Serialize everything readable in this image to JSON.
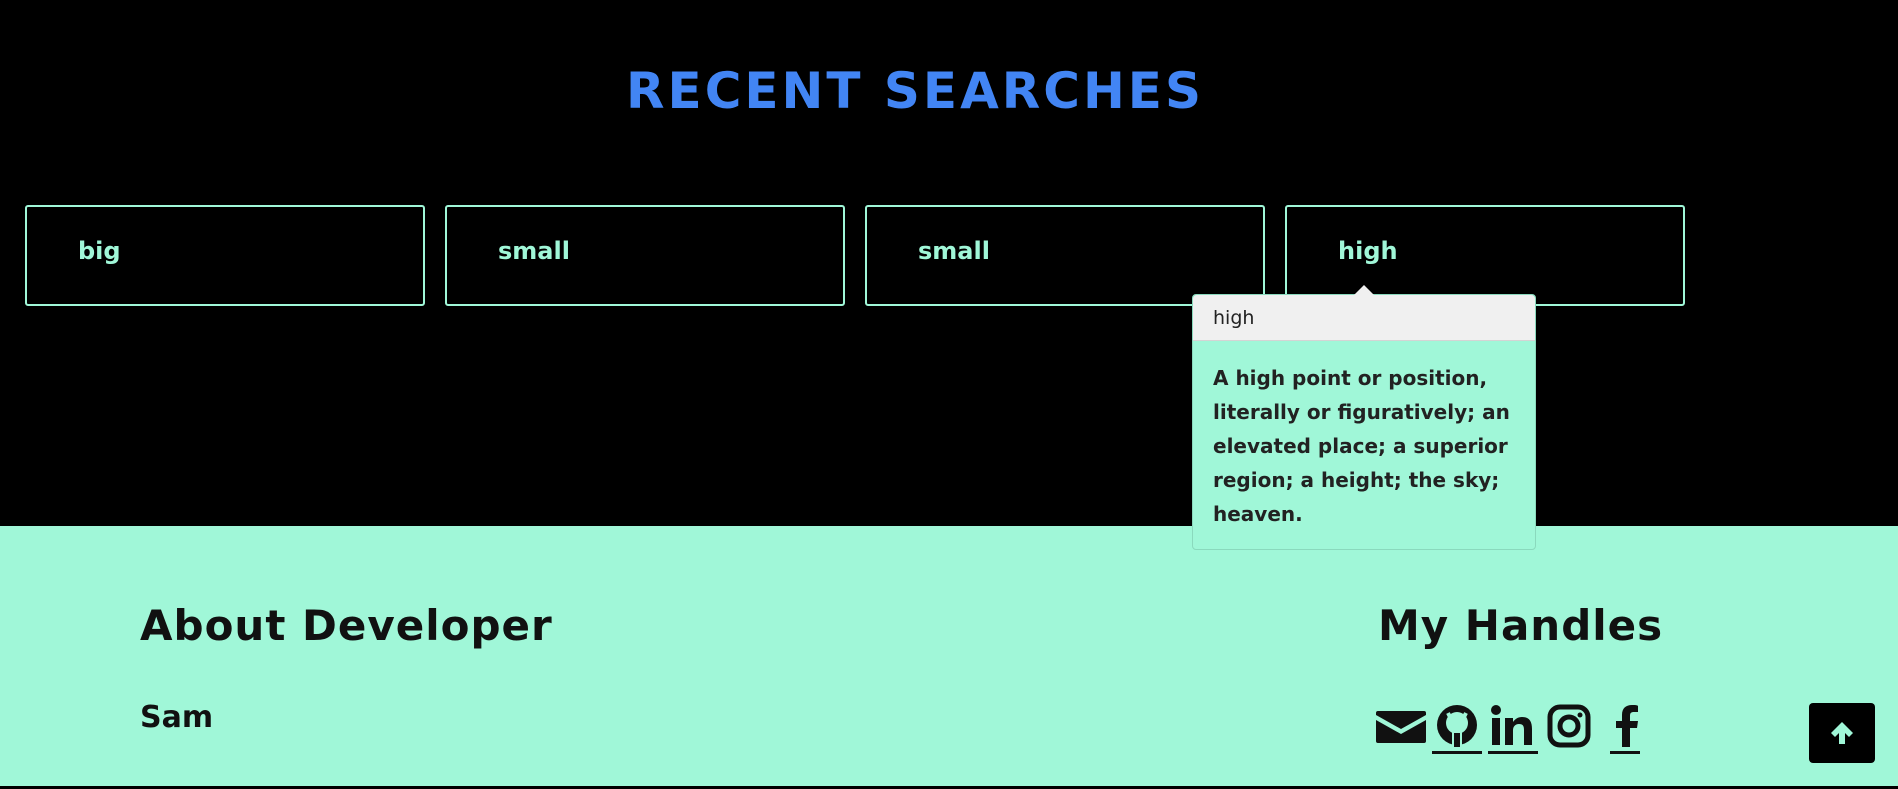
{
  "recent": {
    "title": "RECENT SEARCHES",
    "items": [
      {
        "label": "big"
      },
      {
        "label": "small"
      },
      {
        "label": "small"
      },
      {
        "label": "high"
      }
    ]
  },
  "popover": {
    "title": "high",
    "definition": "A high point or position, literally or figuratively; an elevated place; a superior region; a height; the sky; heaven."
  },
  "footer": {
    "about_title": "About Developer",
    "developer_name": "Sam",
    "handles_title": "My Handles",
    "handles": [
      {
        "icon": "envelope-icon"
      },
      {
        "icon": "github-icon"
      },
      {
        "icon": "linkedin-icon"
      },
      {
        "icon": "instagram-icon"
      },
      {
        "icon": "facebook-icon"
      }
    ]
  },
  "scroll_top": {
    "icon": "arrow-up-icon"
  },
  "colors": {
    "background": "#000000",
    "accent": "#a0f7d8",
    "title_blue": "#4285f4",
    "popover_header": "#f0f0f0"
  }
}
